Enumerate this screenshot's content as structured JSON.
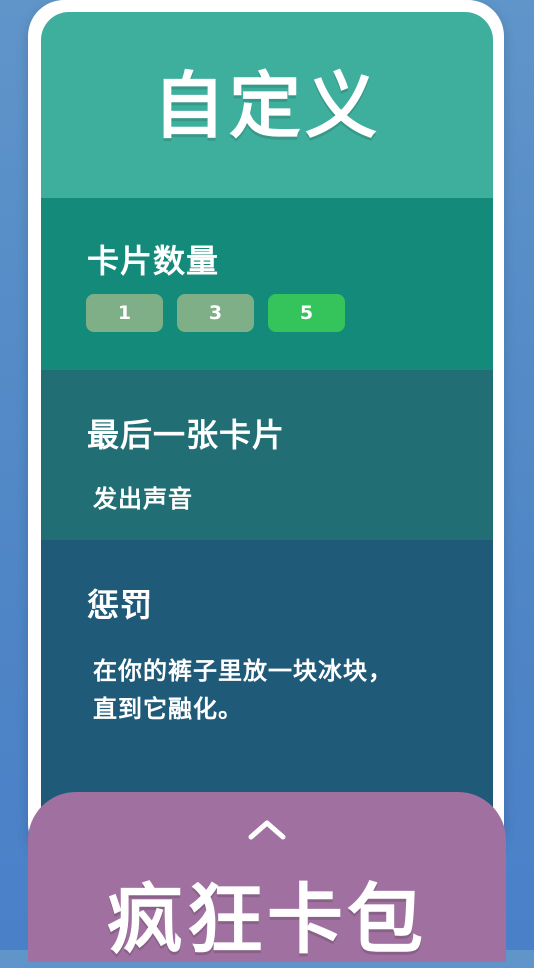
{
  "header": {
    "title": "自定义"
  },
  "card_count": {
    "title": "卡片数量",
    "options": [
      "1",
      "3",
      "5"
    ],
    "selected": "5"
  },
  "last_card": {
    "title": "最后一张卡片",
    "value": "发出声音"
  },
  "penalty": {
    "title": "惩罚",
    "line1": "在你的裤子里放一块冰块，",
    "line2": "直到它融化。"
  },
  "bottom_sheet": {
    "icon": "chevron-up-icon",
    "title": "疯狂卡包"
  },
  "colors": {
    "header": "#3eae9d",
    "section_cards": "#148a7b",
    "section_last": "#216f74",
    "section_penalty": "#1f5a78",
    "option_default": "#7faf86",
    "option_selected": "#35c45c",
    "bottom_sheet": "#a071a0"
  }
}
